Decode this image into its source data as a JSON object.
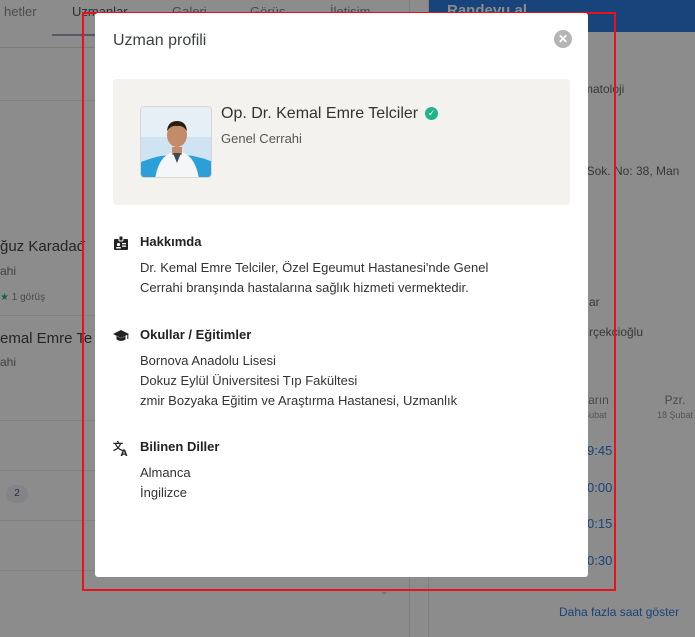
{
  "background": {
    "tabs": [
      "hetler",
      "Uzmanlar",
      "Galeri",
      "Görüş",
      "İletişim"
    ],
    "experts": [
      {
        "name": "ğuz Karadađ",
        "role": "ahi",
        "rating": "1 görüş"
      },
      {
        "name": "emal Emre Te",
        "role": "ahi"
      }
    ],
    "badge_count": "2",
    "appointment": {
      "header": "Randevu al",
      "lines": [
        "matoloji",
        "' Sok. No: 38, Man",
        "ar",
        "rçekcioğlu"
      ],
      "days": [
        {
          "label": "Yarın",
          "date": "Şubat"
        },
        {
          "label": "Pzr.",
          "date": "18 Şubat"
        }
      ],
      "slots": [
        "9:45",
        "0:00",
        "0:15",
        "0:30"
      ],
      "more_link": "Daha fazla saat göster"
    }
  },
  "modal": {
    "title": "Uzman profili",
    "close_label": "✕",
    "doctor": {
      "name": "Op. Dr. Kemal Emre Telciler",
      "specialty": "Genel Cerrahi",
      "verified": true
    },
    "sections": [
      {
        "icon": "id-badge-icon",
        "title": "Hakkımda",
        "lines": [
          "Dr. Kemal Emre Telciler, Özel Egeumut Hastanesi'nde Genel",
          "Cerrahi branşında hastalarına sağlık hizmeti vermektedir."
        ]
      },
      {
        "icon": "graduation-cap-icon",
        "title": "Okullar / Eğitimler",
        "lines": [
          "Bornova Anadolu Lisesi",
          "Dokuz Eylül Üniversitesi Tıp Fakültesi",
          "zmir Bozyaka Eğitim ve Araştırma Hastanesi, Uzmanlık"
        ]
      },
      {
        "icon": "translate-icon",
        "title": "Bilinen Diller",
        "lines": [
          "Almanca",
          "İngilizce"
        ]
      }
    ]
  },
  "colors": {
    "accent": "#2c7be0",
    "verified": "#1fb48a",
    "card_bg": "#f4f2ee",
    "highlight": "#e8121b"
  }
}
